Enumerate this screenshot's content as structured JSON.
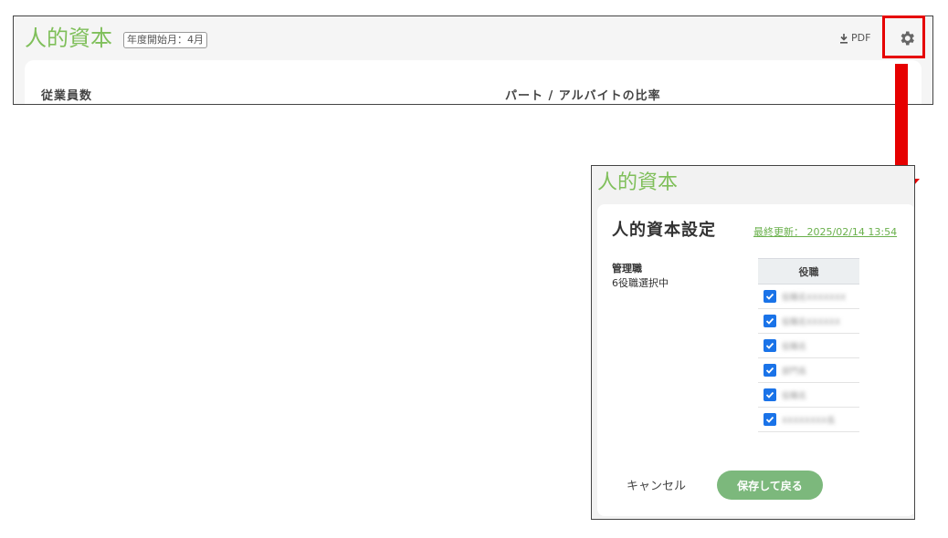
{
  "top": {
    "title": "人的資本",
    "fiscal_badge": "年度開始月：4月",
    "pdf_label": "PDF",
    "col1_label": "従業員数",
    "col2_label": "パート / アルバイトの比率"
  },
  "dialog": {
    "page_title": "人的資本",
    "heading": "人的資本設定",
    "last_update": "最終更新： 2025/02/14 13:54",
    "manager_label": "管理職",
    "manager_count": "6役職選択中",
    "table_header": "役職",
    "roles": [
      {
        "label": "役職名XXXXXXX",
        "checked": true
      },
      {
        "label": "役職名XXXXXX",
        "checked": true
      },
      {
        "label": "役職名",
        "checked": true
      },
      {
        "label": "部門長",
        "checked": true
      },
      {
        "label": "役職名",
        "checked": true
      },
      {
        "label": "XXXXXXXX長",
        "checked": true
      }
    ],
    "cancel_label": "キャンセル",
    "save_label": "保存して戻る"
  },
  "icons": {
    "download": "download-icon",
    "settings": "gear-icon",
    "checkbox": "checkbox-checked-icon"
  },
  "colors": {
    "accent_green": "#7fbf5a",
    "highlight_red": "#e60000",
    "checkbox_blue": "#1a73e8",
    "save_button": "#7cb87c"
  }
}
